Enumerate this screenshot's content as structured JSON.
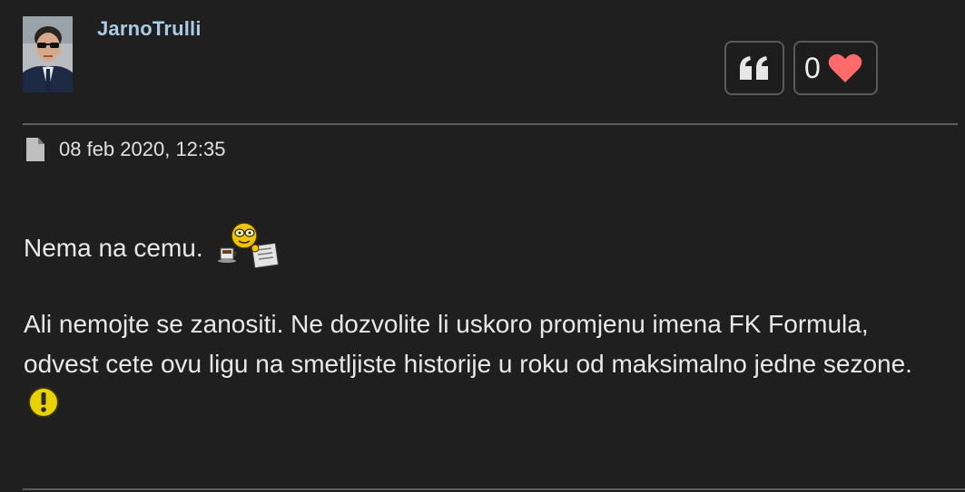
{
  "post": {
    "author": {
      "username": "JarnoTrulli",
      "avatar_icon": "user-avatar-photo"
    },
    "actions": {
      "quote_icon": "quote-icon",
      "like_count": "0",
      "like_icon": "heart-icon"
    },
    "meta": {
      "icon": "document-icon",
      "date": "08 feb 2020, 12:35"
    },
    "body": {
      "paragraph1": "Nema na cemu.",
      "paragraph1_emoji": "coffee-newspaper-smiley-icon",
      "paragraph2": "Ali nemojte se zanositi. Ne dozvolite li uskoro promjenu imena FK Formula, odvest cete ovu ligu na smetljiste historije u roku od maksimalno jedne sezone.",
      "paragraph2_emoji": "exclamation-smiley-icon"
    },
    "colors": {
      "background": "#1f1f1f",
      "username": "#aacbe6",
      "heart": "#ff6b6b",
      "divider": "#5d5d5d"
    }
  }
}
